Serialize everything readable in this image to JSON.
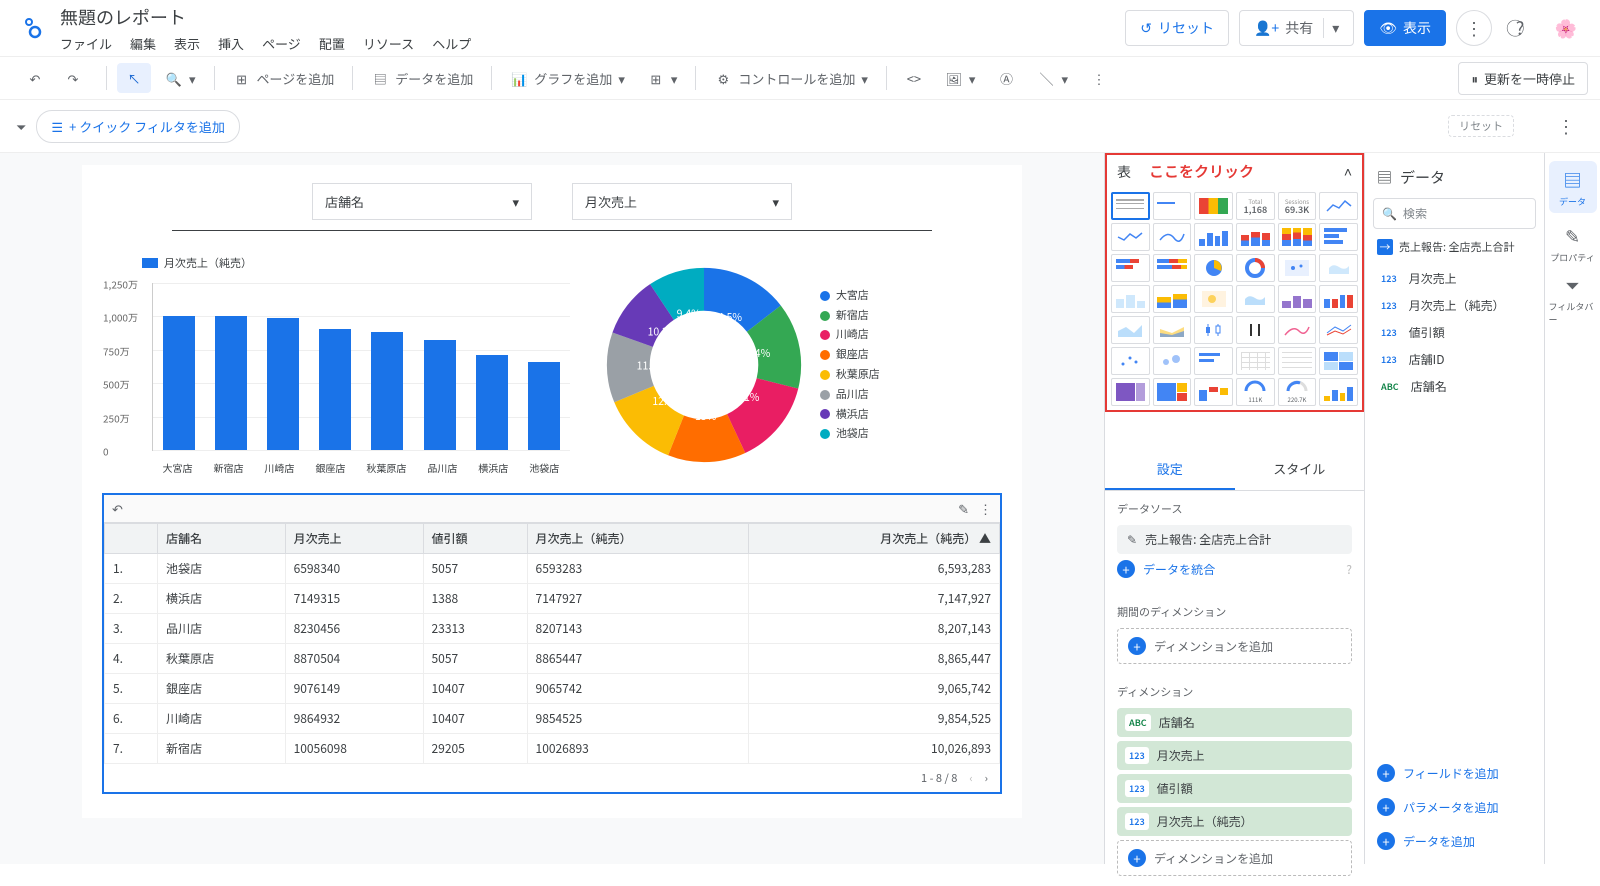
{
  "header": {
    "title": "無題のレポート",
    "menus": [
      "ファイル",
      "編集",
      "表示",
      "挿入",
      "ページ",
      "配置",
      "リソース",
      "ヘルプ"
    ],
    "reset": "リセット",
    "share": "共有",
    "view": "表示"
  },
  "toolbar": {
    "add_page": "ページを追加",
    "add_data": "データを追加",
    "add_chart": "グラフを追加",
    "add_control": "コントロールを追加",
    "pause": "更新を一時停止"
  },
  "filterbar": {
    "quick": "+ クイック フィルタを追加",
    "reset": "リセット"
  },
  "controls": {
    "store_label": "店舗名",
    "sales_label": "月次売上"
  },
  "bar_legend": "月次売上（純売）",
  "chart_data": {
    "bar": {
      "type": "bar",
      "title": "",
      "ylabel": "",
      "ylim": [
        0,
        12500000
      ],
      "yticks": [
        "1,250万",
        "1,000万",
        "750万",
        "500万",
        "250万",
        "0"
      ],
      "categories": [
        "大宮店",
        "新宿店",
        "川崎店",
        "銀座店",
        "秋葉原店",
        "品川店",
        "横浜店",
        "池袋店"
      ],
      "values": [
        10026893,
        10026893,
        9854525,
        9065742,
        8865447,
        8207143,
        7147927,
        6593283
      ]
    },
    "donut": {
      "type": "pie",
      "title": "",
      "series": [
        {
          "name": "大宮店",
          "value": 14.5,
          "color": "#1a73e8"
        },
        {
          "name": "新宿店",
          "value": 14.4,
          "color": "#34a853"
        },
        {
          "name": "川崎店",
          "value": 14.1,
          "color": "#e91e63"
        },
        {
          "name": "銀座店",
          "value": 13.0,
          "color": "#ff6d00"
        },
        {
          "name": "秋葉原店",
          "value": 12.7,
          "color": "#fbbc04"
        },
        {
          "name": "品川店",
          "value": 11.7,
          "color": "#9aa0a6"
        },
        {
          "name": "横浜店",
          "value": 10.2,
          "color": "#673ab7"
        },
        {
          "name": "池袋店",
          "value": 9.4,
          "color": "#00acc1"
        }
      ]
    }
  },
  "table": {
    "columns": [
      "",
      "店舗名",
      "月次売上",
      "値引額",
      "月次売上（純売）",
      "月次売上（純売）"
    ],
    "sort_col": 5,
    "rows": [
      [
        "1.",
        "池袋店",
        "6598340",
        "5057",
        "6593283",
        "6,593,283"
      ],
      [
        "2.",
        "横浜店",
        "7149315",
        "1388",
        "7147927",
        "7,147,927"
      ],
      [
        "3.",
        "品川店",
        "8230456",
        "23313",
        "8207143",
        "8,207,143"
      ],
      [
        "4.",
        "秋葉原店",
        "8870504",
        "5057",
        "8865447",
        "8,865,447"
      ],
      [
        "5.",
        "銀座店",
        "9076149",
        "10407",
        "9065742",
        "9,065,742"
      ],
      [
        "6.",
        "川崎店",
        "9864932",
        "10407",
        "9854525",
        "9,854,525"
      ],
      [
        "7.",
        "新宿店",
        "10056098",
        "29205",
        "10026893",
        "10,026,893"
      ]
    ],
    "pager": "1 - 8 / 8"
  },
  "popup": {
    "title": "表",
    "annotation": "ここをクリック",
    "scorecard1": {
      "label": "Total",
      "value": "1,168"
    },
    "scorecard2": {
      "label": "Sessions",
      "value": "69.3K"
    },
    "gauge1": "111K",
    "gauge2": "220.7K"
  },
  "setup": {
    "tab_setup": "設定",
    "tab_style": "スタイル",
    "datasource_lbl": "データソース",
    "datasource": "売上報告: 全店売上合計",
    "blend": "データを統合",
    "date_dim_lbl": "期間のディメンション",
    "add_dim": "ディメンションを追加",
    "dim_lbl": "ディメンション",
    "dims": [
      {
        "type": "ABC",
        "label": "店舗名"
      },
      {
        "type": "123",
        "label": "月次売上"
      },
      {
        "type": "123",
        "label": "値引額"
      },
      {
        "type": "123",
        "label": "月次売上（純売）"
      }
    ]
  },
  "datapanel": {
    "title": "データ",
    "search": "検索",
    "source": "売上報告: 全店売上合計",
    "fields": [
      {
        "type": "123",
        "label": "月次売上"
      },
      {
        "type": "123",
        "label": "月次売上（純売）"
      },
      {
        "type": "123",
        "label": "値引額"
      },
      {
        "type": "123",
        "label": "店舗ID"
      },
      {
        "type": "ABC",
        "label": "店舗名"
      }
    ],
    "add_field": "フィールドを追加",
    "add_param": "パラメータを追加",
    "add_data": "データを追加"
  },
  "rail": {
    "data": "データ",
    "props": "プロパティ",
    "filter": "フィルタバー"
  }
}
